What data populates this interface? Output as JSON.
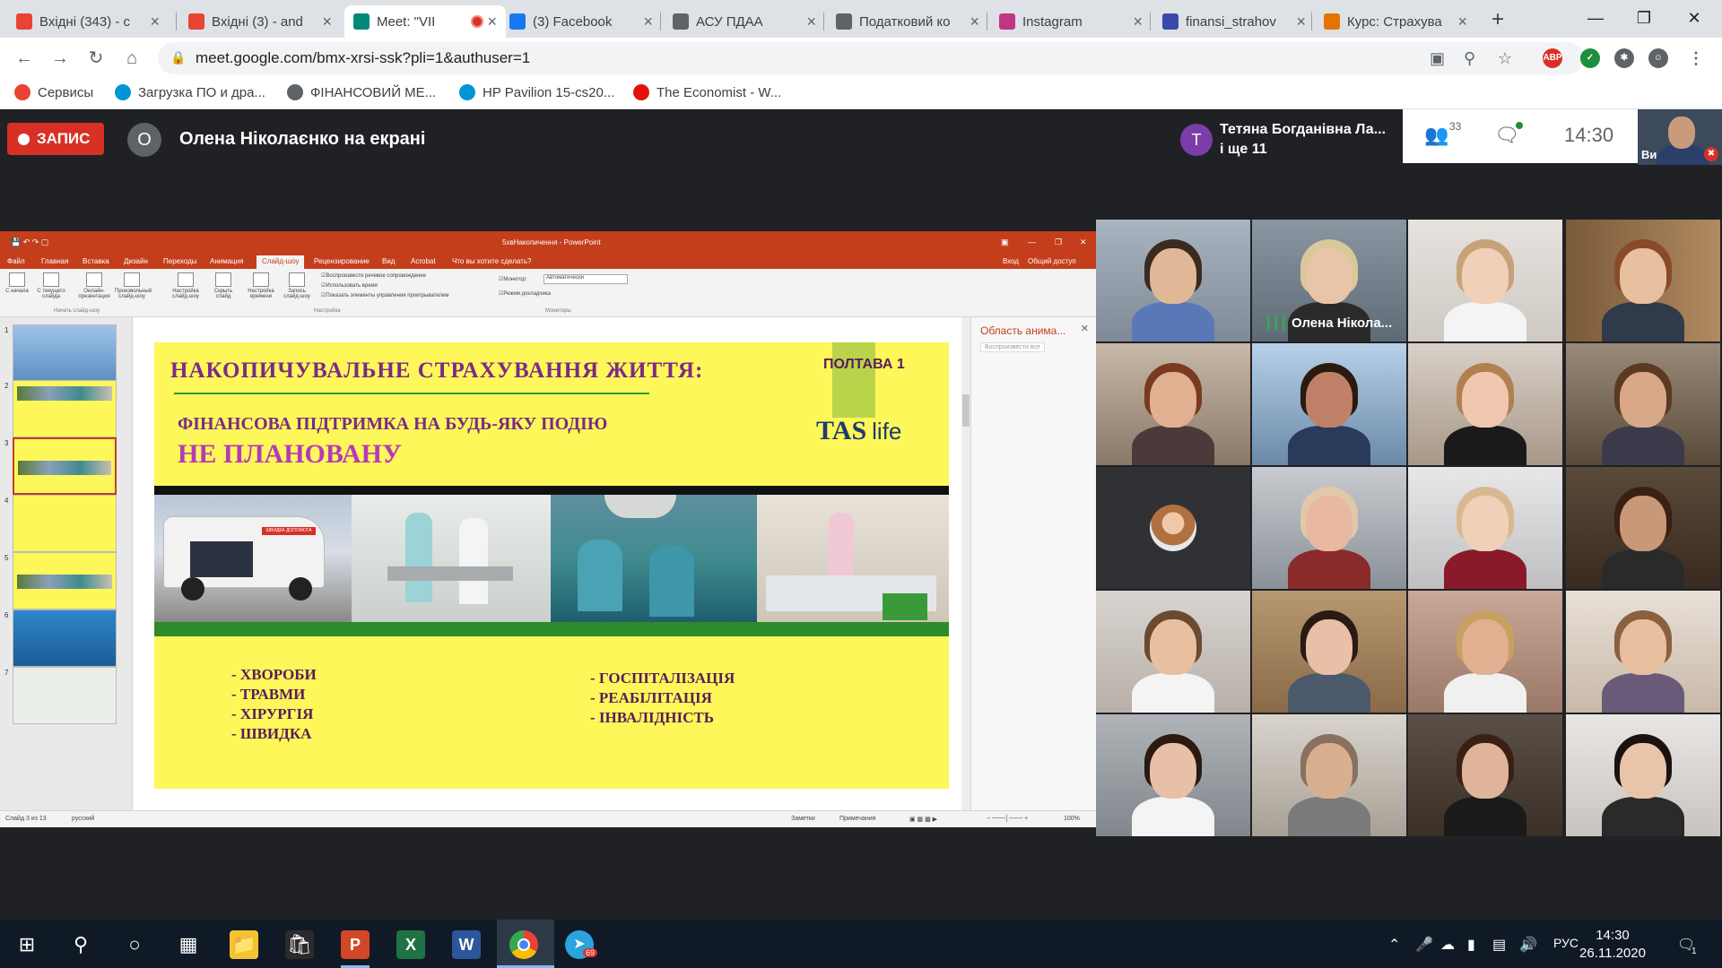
{
  "browser": {
    "tabs": [
      {
        "title": "Вхідні (343) - c",
        "icon": "gmail-icon",
        "color": "#ea4335"
      },
      {
        "title": "Вхідні (3) - and",
        "icon": "gmail-icon",
        "color": "#ea4335"
      },
      {
        "title": "Meet: \"VII",
        "icon": "meet-icon",
        "color": "#00897b",
        "active": true,
        "recording": true
      },
      {
        "title": "(3) Facebook",
        "icon": "facebook-icon",
        "color": "#1877f2"
      },
      {
        "title": "АСУ ПДАА",
        "icon": "globe-icon",
        "color": "#5f6368"
      },
      {
        "title": "Податковий ко",
        "icon": "building-icon",
        "color": "#5f6368"
      },
      {
        "title": "Instagram",
        "icon": "instagram-icon",
        "color": "#c13584"
      },
      {
        "title": "finansi_strahov",
        "icon": "document-icon",
        "color": "#3949ab"
      },
      {
        "title": "Курс: Страхува",
        "icon": "course-icon",
        "color": "#e37400"
      }
    ],
    "url": "meet.google.com/bmx-xrsi-ssk?pli=1&authuser=1",
    "bookmarks": [
      {
        "label": "Сервисы",
        "icon": "apps-grid-icon",
        "color": "#ea4335"
      },
      {
        "label": "Загрузка ПО и дра...",
        "icon": "hp-icon",
        "color": "#0096d6"
      },
      {
        "label": "ФІНАНСОВИЙ МЕ...",
        "icon": "globe-icon",
        "color": "#5f6368"
      },
      {
        "label": "HP Pavilion 15-cs20...",
        "icon": "hp-icon",
        "color": "#0096d6"
      },
      {
        "label": "The Economist - W...",
        "icon": "economist-icon",
        "color": "#e3120b"
      }
    ]
  },
  "meet": {
    "record_label": "ЗАПИС",
    "presenter_initial": "О",
    "presenting_text": "Олена Ніколаєнко на екрані",
    "participants_chip": {
      "initial": "Т",
      "name": "Тетяна Богданівна Ла...",
      "more": "і ще 11"
    },
    "people_count": "33",
    "time": "14:30",
    "self_label": "Ви",
    "speaker_name": "Олена Ніколa..."
  },
  "powerpoint": {
    "window_title": "5хвНакопичення - PowerPoint",
    "ribbon_tabs": [
      "Файл",
      "Главная",
      "Вставка",
      "Дизайн",
      "Переходы",
      "Анимация",
      "Слайд-шоу",
      "Рецензирование",
      "Вид",
      "Acrobat",
      "Что вы хотите сделать?"
    ],
    "ribbon_right": [
      "Вход",
      "Общий доступ"
    ],
    "ribbon_buttons": [
      "С начала",
      "С текущего слайда",
      "Онлайн-презентация",
      "Произвольный слайд-шоу",
      "Настройка слайд-шоу",
      "Скрыть слайд",
      "Настройка времени",
      "Запись слайд-шоу"
    ],
    "ribbon_checks": [
      "Воспроизвести речевое сопровождение",
      "Использовать время",
      "Показать элементы управления проигрывателем",
      "Режим докладчика"
    ],
    "monitor_label": "Монитор:",
    "monitor_value": "Автоматически",
    "groups": [
      "Начать слайд-шоу",
      "Настройка",
      "Мониторы"
    ],
    "thumb_numbers": [
      "1",
      "2",
      "3",
      "4",
      "5",
      "6",
      "7"
    ],
    "anim_pane_title": "Область анима...",
    "anim_pane_btn": "Воспроизвести все",
    "status_left": [
      "Слайд 3 из 13",
      "русский"
    ],
    "status_right": [
      "Заметки",
      "Примечания",
      "100%"
    ]
  },
  "slide": {
    "title": "НАКОПИЧУВАЛЬНЕ  СТРАХУВАННЯ  ЖИТТЯ:",
    "subtitle1": "ФІНАНСОВА ПІДТРИМКА НА БУДЬ-ЯКУ ПОДІЮ",
    "subtitle2": "НЕ ПЛАНОВАНУ",
    "badge": "ПОЛТАВА 1",
    "logo_main": "TAS",
    "logo_sub": "life",
    "ambulance_text": "ШВИДКА ДОПОМОГА",
    "list_left": [
      "ХВОРОБИ",
      "ТРАВМИ",
      "ХІРУРГІЯ",
      "ШВИДКА"
    ],
    "list_right": [
      "ГОСПІТАЛІЗАЦІЯ",
      "РЕАБІЛІТАЦІЯ",
      "ІНВАЛІДНІСТЬ"
    ]
  },
  "taskbar": {
    "apps": [
      "windows-start-icon",
      "search-icon",
      "cortana-icon",
      "task-view-icon",
      "file-explorer-icon",
      "store-icon",
      "powerpoint-icon",
      "excel-icon",
      "word-icon",
      "chrome-icon",
      "telegram-icon"
    ],
    "telegram_badge": "69",
    "lang": "РУС",
    "time": "14:30",
    "date": "26.11.2020",
    "notification_count": "1"
  }
}
